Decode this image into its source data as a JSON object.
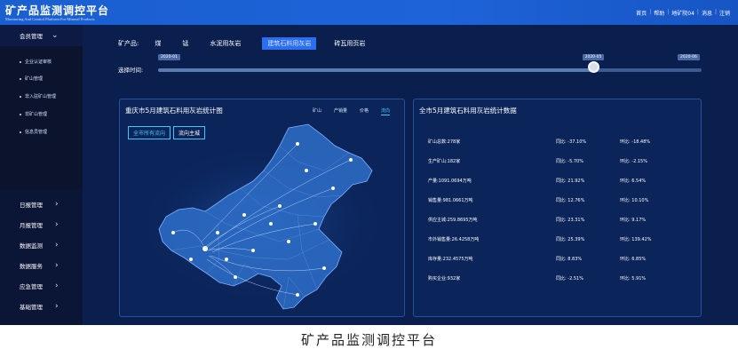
{
  "app": {
    "title": "矿产品监测调控平台",
    "subtitle": "Monitoring And Control Platform For Mineral Products",
    "top_links": [
      "首页",
      "帮助",
      "地矿院04",
      "消息",
      "注销"
    ]
  },
  "sidebar": {
    "head": "会员管理",
    "sub_items": [
      "企业认证审核",
      "矿山管理",
      "非入驻矿山管理",
      "非矿山管理",
      "信息员管理"
    ],
    "items": [
      "日报管理",
      "月报管理",
      "数据监测",
      "数据服务",
      "应急管理",
      "基础管理"
    ]
  },
  "filter": {
    "label": "矿产品:",
    "options": [
      "煤",
      "锰",
      "水泥用灰岩",
      "建筑石料用灰岩",
      "砖瓦用页岩"
    ],
    "active": "建筑石料用灰岩"
  },
  "time": {
    "label": "选择时间:",
    "start_badge": "2020-01",
    "current_badge": "2020-05",
    "end_badge": "2020-06",
    "position_fraction": 0.8
  },
  "map_panel": {
    "title": "重庆市5月建筑石料用灰岩统计图",
    "tabs": [
      "矿山",
      "产销量",
      "价格",
      "流向"
    ],
    "active_tab": "流向",
    "buttons": [
      "全市所有流向",
      "流向主城"
    ]
  },
  "stats_panel": {
    "title": "全市5月建筑石料用灰岩统计数据",
    "rows": [
      {
        "label": "矿山总数:278家",
        "yoy": "同比: -37.10%",
        "mom": "环比: -18.48%"
      },
      {
        "label": "生产矿山:182家",
        "yoy": "同比: -5.70%",
        "mom": "环比: -2.15%"
      },
      {
        "label": "产量:1091.0694万吨",
        "yoy": "同比: 21.92%",
        "mom": "环比: 6.54%"
      },
      {
        "label": "销售量:981.0661万吨",
        "yoy": "同比: 12.76%",
        "mom": "环比: 10.10%"
      },
      {
        "label": "供应主城:259.8695万吨",
        "yoy": "同比: 23.31%",
        "mom": "环比: 9.17%"
      },
      {
        "label": "市外销售量:26.4258万吨",
        "yoy": "同比: 25.39%",
        "mom": "环比: 139.42%"
      },
      {
        "label": "库存量:232.4575万吨",
        "yoy": "同比: 8.83%",
        "mom": "环比: 6.85%"
      },
      {
        "label": "购买企业:932家",
        "yoy": "同比: -2.51%",
        "mom": "环比: 5.91%"
      }
    ]
  },
  "caption": "矿产品监测调控平台",
  "colors": {
    "header": "#1e63d8",
    "background": "#0a1f4e",
    "accent": "#3ec8ff",
    "active_option": "#2b6ff0"
  }
}
